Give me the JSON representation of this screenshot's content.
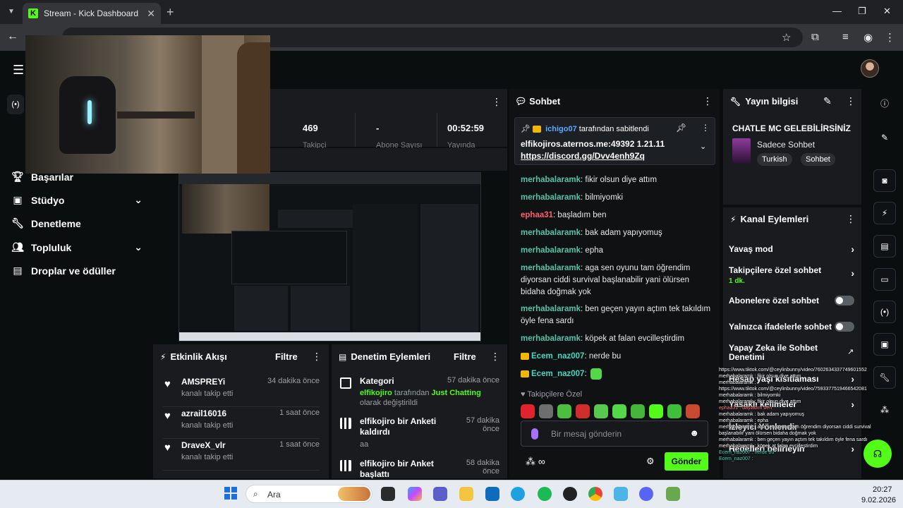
{
  "browser": {
    "tab_title": "Stream - Kick Dashboard",
    "tab_favicon": "K",
    "address_placeholder": ""
  },
  "sidebar": {
    "items": [
      {
        "label": "Başarılar",
        "icon": "trophy-icon"
      },
      {
        "label": "Stüdyo",
        "icon": "studio-icon",
        "expandable": true
      },
      {
        "label": "Denetleme",
        "icon": "wrench-icon"
      },
      {
        "label": "Topluluk",
        "icon": "people-icon",
        "expandable": true
      },
      {
        "label": "Droplar ve ödüller",
        "icon": "gift-icon"
      }
    ]
  },
  "stats": {
    "viewers": "469",
    "subscribers_value": "-",
    "uptime": "00:52:59",
    "labels": [
      "Takipçi",
      "Abone Sayısı",
      "Yayında"
    ]
  },
  "activity": {
    "title": "Etkinlik Akışı",
    "filter": "Filtre",
    "items": [
      {
        "name": "AMSPREYi",
        "action": "kanalı takip etti",
        "time": "34 dakika önce"
      },
      {
        "name": "azrail16016",
        "action": "kanalı takip etti",
        "time": "1 saat önce"
      },
      {
        "name": "DraveX_vlr",
        "action": "kanalı takip etti",
        "time": "1 saat önce"
      }
    ]
  },
  "moderation": {
    "title": "Denetim Eylemleri",
    "filter": "Filtre",
    "items": [
      {
        "title": "Kategori",
        "time": "57 dakika önce",
        "user": "elfikojiro",
        "mid": "tarafından",
        "highlight": "Just Chatting",
        "tail": "olarak değiştirildi"
      },
      {
        "title": "elfikojiro bir Anketi kaldırdı",
        "time": "57 dakika önce",
        "desc": "aa"
      },
      {
        "title": "elfikojiro bir Anket başlattı",
        "time": "58 dakika önce"
      }
    ]
  },
  "chat": {
    "title": "Sohbet",
    "pinned": {
      "user": "ichigo07",
      "by_text": "tarafından sabitlendi",
      "line1": "elfikojiros.aternos.me:49392 1.21.11",
      "line2": "https://discord.gg/Dvv4enh9Zq"
    },
    "messages": [
      {
        "user": "merhabalaramk",
        "color": "green",
        "text": "fikir olsun diye attım"
      },
      {
        "user": "merhabalaramk",
        "color": "green",
        "text": "bilmiyomki"
      },
      {
        "user": "ephaa31",
        "color": "red",
        "text": "başladım ben"
      },
      {
        "user": "merhabalaramk",
        "color": "green",
        "text": "bak adam yapıyomuş"
      },
      {
        "user": "merhabalaramk",
        "color": "green",
        "text": "epha"
      },
      {
        "user": "merhabalaramk",
        "color": "green",
        "text": "aga sen oyunu tam öğrendim diyorsan ciddi survival başlanabilir yani ölürsen bidaha doğmak yok"
      },
      {
        "user": "merhabalaramk",
        "color": "green",
        "text": "ben geçen yayın açtım tek takıldım öyle fena sardı"
      },
      {
        "user": "merhabalaramk",
        "color": "green",
        "text": "köpek at falan evcilleştirdim"
      },
      {
        "user": "Ecem_naz007",
        "color": "teal",
        "text": "nerde bu"
      },
      {
        "user": "Ecem_naz007",
        "color": "teal",
        "text": ""
      }
    ],
    "followers_only": "Takipçilere Özel",
    "input_placeholder": "Bir mesaj gönderin",
    "send_label": "Gönder"
  },
  "stream_info": {
    "title": "Yayın bilgisi",
    "stream_title": "CHATLE MC GELEBİLİRSİNİZ",
    "category": "Sadece Sohbet",
    "tags": [
      "Turkish",
      "Sohbet"
    ]
  },
  "channel_actions": {
    "title": "Kanal Eylemleri",
    "items": [
      {
        "label": "Yavaş mod",
        "type": "chevron"
      },
      {
        "label": "Takipçilere özel sohbet",
        "sub": "1 dk.",
        "type": "chevron"
      },
      {
        "label": "Abonelere özel sohbet",
        "type": "toggle"
      },
      {
        "label": "Yalnızca ifadelerle sohbet",
        "type": "toggle"
      },
      {
        "label": "Yapay Zeka ile Sohbet Denetimi",
        "type": "external"
      },
      {
        "label": "Hesap yaşı kısıtlaması",
        "type": "chevron"
      },
      {
        "label": "Yasaklı kelimeler",
        "type": "chevron"
      },
      {
        "label": "İzleyici Yönlendir",
        "type": "none"
      },
      {
        "label": "Hedefleri belirleyin",
        "type": "chevron"
      }
    ]
  },
  "overlay_lines": [
    "https://www.tiktok.com/@ceylinbunny/video/7602634337749601552",
    "merhabalaramk : fikir olsun diye attım",
    "merhabalaramk :",
    "https://www.tiktok.com/@ceylinbunny/video/7593377519466542081",
    "merhabalaramk : bilmiyomki",
    "merhabalaramk : fikir olsun diye attım",
    "ephaa31 : başladım ben",
    "merhabalaramk : bak adam yapıyomuş",
    "merhabalaramk : epha",
    "merhabalaramk : aga sen oyunu tam öğrendim diyorsan ciddi survival",
    "başlanabilir yani ölürsen bidaha doğmak yok",
    "merhabalaramk : ben geçen yayın açtım tek takıldım öyle fena sardı",
    "merhabalaramk : köpek at falan evcilleştirdim",
    "Ecem_naz007 : nerde bu",
    "Ecem_naz007 :"
  ],
  "taskbar": {
    "search_label": "Ara",
    "time": "20:27",
    "date": "9.02.2026"
  },
  "colors": {
    "accent": "#53fc18",
    "panel": "#191b1f",
    "background": "#0b0e0f"
  }
}
